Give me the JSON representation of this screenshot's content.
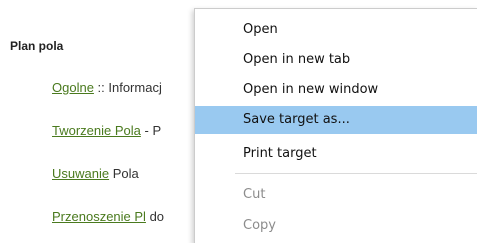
{
  "content": {
    "heading": "Plan pola",
    "items": [
      {
        "link": "Ogolne",
        "text": " :: Informacj"
      },
      {
        "link": "Tworzenie Pola",
        "text": " - P"
      },
      {
        "link": "Usuwanie",
        "text": " Pola"
      },
      {
        "link": "Przenoszenie Pl",
        "text": " do"
      }
    ]
  },
  "context_menu": {
    "items": [
      {
        "label": "Open",
        "state": "normal"
      },
      {
        "label": "Open in new tab",
        "state": "normal"
      },
      {
        "label": "Open in new window",
        "state": "normal"
      },
      {
        "label": "Save target as...",
        "state": "highlighted"
      },
      {
        "label": "Print target",
        "state": "normal"
      },
      {
        "label": "Cut",
        "state": "disabled"
      },
      {
        "label": "Copy",
        "state": "disabled"
      }
    ]
  },
  "colors": {
    "link": "#4a7a1e",
    "menu_highlight": "#99c9f0",
    "disabled_text": "#8c8c8c"
  }
}
